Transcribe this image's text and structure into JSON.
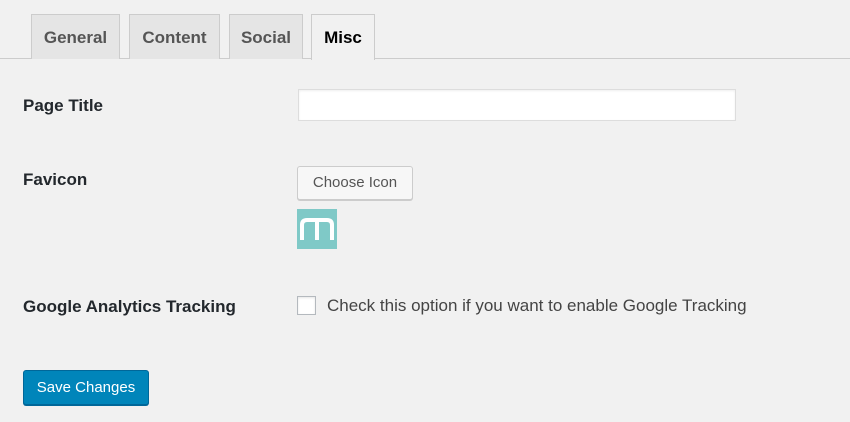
{
  "tabs": [
    {
      "label": "General",
      "active": false
    },
    {
      "label": "Content",
      "active": false
    },
    {
      "label": "Social",
      "active": false
    },
    {
      "label": "Misc",
      "active": true
    }
  ],
  "fields": {
    "page_title": {
      "label": "Page Title",
      "value": "",
      "placeholder": ""
    },
    "favicon": {
      "label": "Favicon",
      "button_label": "Choose Icon",
      "preview_icon": "m-logo-icon",
      "preview_color": "#7fc9c7"
    },
    "google_analytics": {
      "label": "Google Analytics Tracking",
      "checkbox_text": "Check this option if you want to enable Google Tracking",
      "checked": false
    }
  },
  "actions": {
    "save_label": "Save Changes"
  },
  "colors": {
    "background": "#f1f1f1",
    "primary_button": "#0085ba",
    "favicon_tile": "#7fc9c7"
  }
}
